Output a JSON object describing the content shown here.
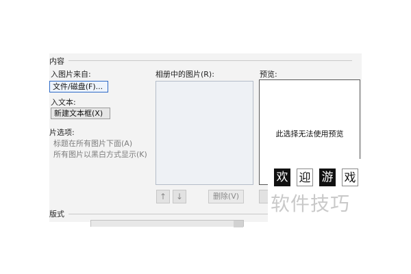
{
  "dialog": {
    "group_title": "内容",
    "insert_from_label": "入图片来自:",
    "file_disk_button": "文件/磁盘(F)...",
    "insert_text_label": "入文本:",
    "new_textbox_button": "新建文本框(X)",
    "picture_options_label": "片选项:",
    "option_captions": "标题在所有图片下面(A)",
    "option_bw": "所有图片以黑白方式显示(K)",
    "album_pictures_label": "相册中的图片(R):",
    "preview_label": "预览:",
    "preview_message": "此选择无法使用预览",
    "move_up_icon_glyph": "↑",
    "move_down_icon_glyph": "↓",
    "remove_button": "删除(V)",
    "layout_group_title": "版式"
  },
  "watermark": {
    "tiles": [
      "欢",
      "迎",
      "游",
      "戏"
    ],
    "text": "软件技巧"
  }
}
